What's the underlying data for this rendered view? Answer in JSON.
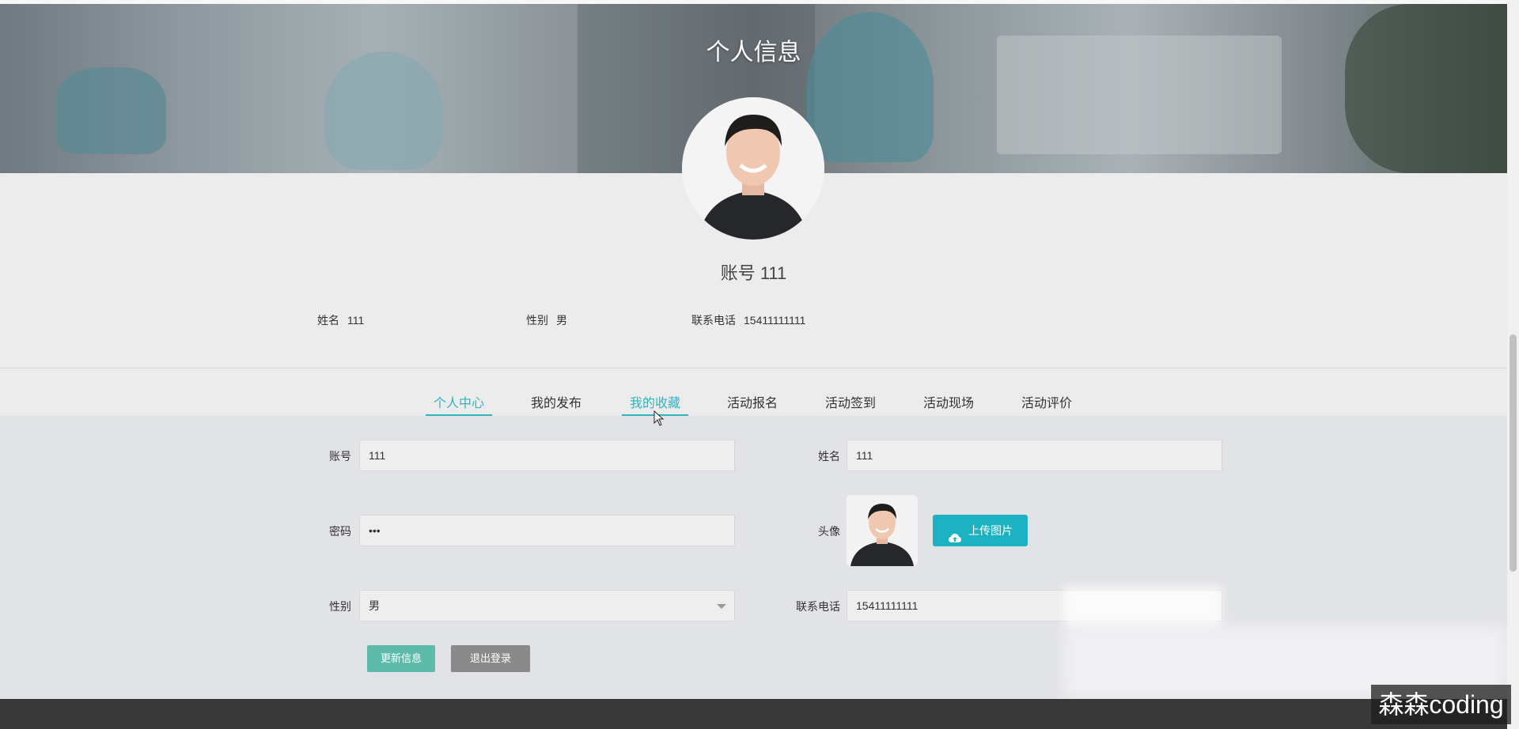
{
  "page": {
    "title": "个人信息",
    "account_heading": "账号 111"
  },
  "summary": {
    "name_label": "姓名",
    "name_value": "111",
    "gender_label": "性别",
    "gender_value": "男",
    "phone_label": "联系电话",
    "phone_value": "15411111111"
  },
  "tabs": [
    {
      "label": "个人中心",
      "active": true
    },
    {
      "label": "我的发布",
      "active": false
    },
    {
      "label": "我的收藏",
      "active": false,
      "hovered": true
    },
    {
      "label": "活动报名",
      "active": false
    },
    {
      "label": "活动签到",
      "active": false
    },
    {
      "label": "活动现场",
      "active": false
    },
    {
      "label": "活动评价",
      "active": false
    }
  ],
  "form": {
    "account_label": "账号",
    "account_value": "111",
    "name_label": "姓名",
    "name_value": "111",
    "password_label": "密码",
    "password_value": "•••",
    "avatar_label": "头像",
    "upload_label": "上传图片",
    "gender_label": "性别",
    "gender_value": "男",
    "phone_label": "联系电话",
    "phone_value": "15411111111",
    "update_button": "更新信息",
    "logout_button": "退出登录"
  },
  "watermark": "森森coding",
  "colors": {
    "accent": "#2fb4c0",
    "upload_button": "#1cb2c2",
    "update_button": "#5fbba9",
    "logout_button": "#8a8a8a",
    "footer": "#383838"
  },
  "icons": {
    "upload": "cloud-upload-icon",
    "select": "chevron-down-icon",
    "cursor": "mouse-pointer-icon"
  }
}
